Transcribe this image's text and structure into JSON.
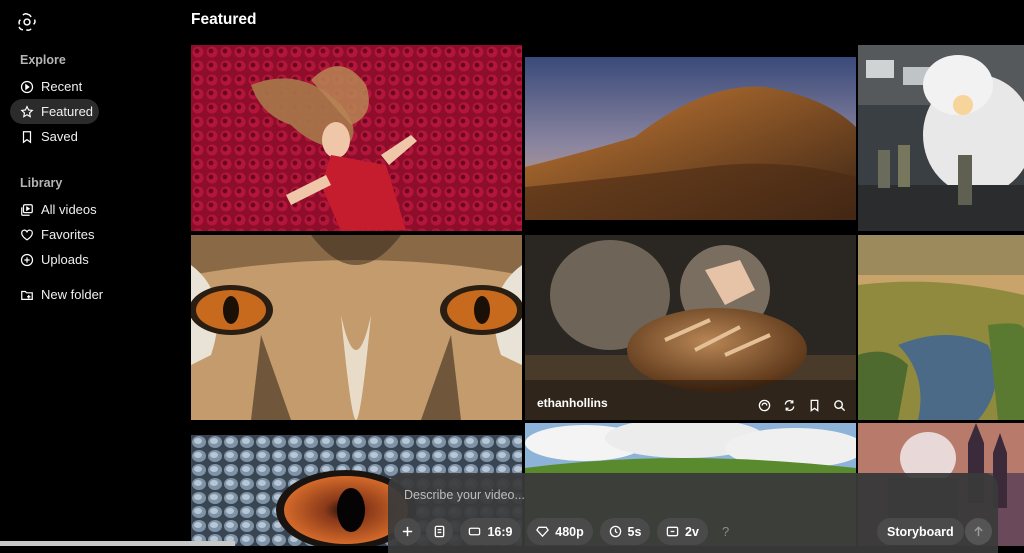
{
  "header": {
    "title": "Featured"
  },
  "sidebar": {
    "explore_title": "Explore",
    "library_title": "Library",
    "explore_items": [
      {
        "label": "Recent",
        "icon": "play-circle-icon"
      },
      {
        "label": "Featured",
        "icon": "star-icon",
        "active": true
      },
      {
        "label": "Saved",
        "icon": "bookmark-icon"
      }
    ],
    "library_items": [
      {
        "label": "All videos",
        "icon": "videos-icon"
      },
      {
        "label": "Favorites",
        "icon": "heart-icon"
      },
      {
        "label": "Uploads",
        "icon": "upload-icon"
      }
    ],
    "new_folder": "New folder"
  },
  "gallery": {
    "tiles": [
      {
        "id": "woman-roses"
      },
      {
        "id": "desert-hill-sunset"
      },
      {
        "id": "steam-train-soldiers"
      },
      {
        "id": "tiger-eyes"
      },
      {
        "id": "bread-hands",
        "hovered": true,
        "username": "ethanhollins"
      },
      {
        "id": "marsh-stream"
      },
      {
        "id": "dragon-eye"
      },
      {
        "id": "green-hills-clouds"
      },
      {
        "id": "fantasy-castle"
      }
    ]
  },
  "composer": {
    "placeholder": "Describe your video...",
    "aspect_ratio": "16:9",
    "resolution": "480p",
    "duration": "5s",
    "variations": "2v",
    "help": "?",
    "storyboard": "Storyboard"
  },
  "colors": {
    "background": "#000000",
    "composer": "#3a3a3a",
    "pill": "#4a4a4a"
  }
}
